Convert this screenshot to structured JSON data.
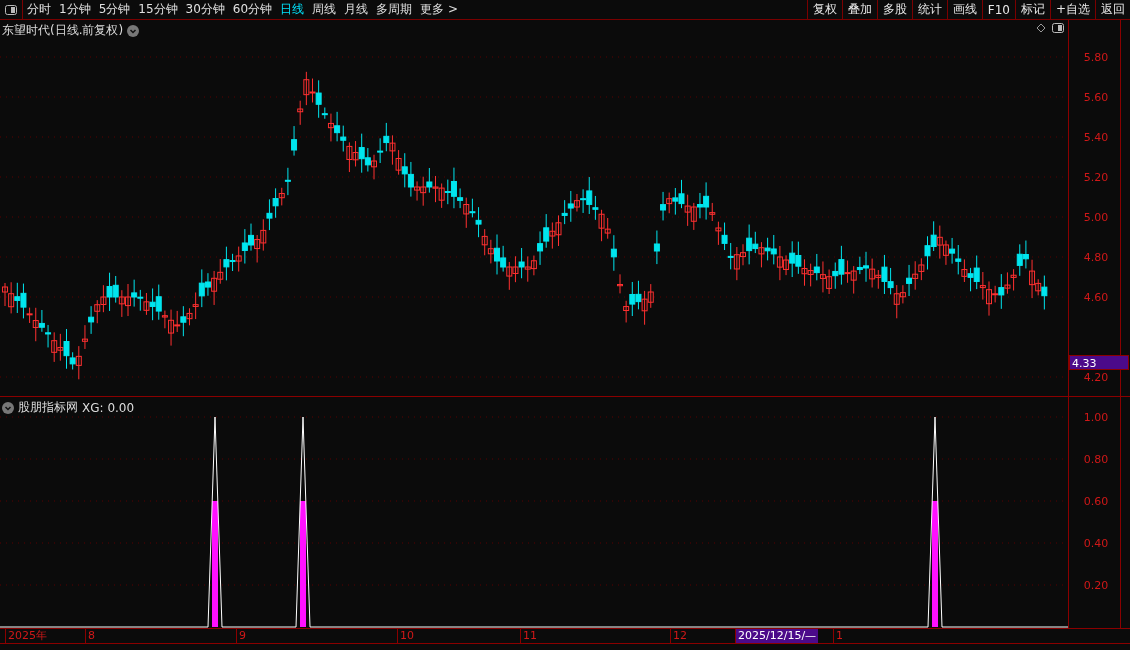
{
  "toolbar": {
    "periods": [
      {
        "label": "分时",
        "selected": false
      },
      {
        "label": "1分钟",
        "selected": false
      },
      {
        "label": "5分钟",
        "selected": false
      },
      {
        "label": "15分钟",
        "selected": false
      },
      {
        "label": "30分钟",
        "selected": false
      },
      {
        "label": "60分钟",
        "selected": false
      },
      {
        "label": "日线",
        "selected": true
      },
      {
        "label": "周线",
        "selected": false
      },
      {
        "label": "月线",
        "selected": false
      },
      {
        "label": "多周期",
        "selected": false
      },
      {
        "label": "更多 >",
        "selected": false
      }
    ],
    "actions": [
      "复权",
      "叠加",
      "多股",
      "统计",
      "画线",
      "F10",
      "标记",
      "+自选",
      "返回"
    ]
  },
  "price_panel": {
    "title": "东望时代(日线.前复权)",
    "axis_labels": [
      "5.80",
      "5.60",
      "5.40",
      "5.20",
      "5.00",
      "4.80",
      "4.60",
      "4.20"
    ],
    "current_price": "4.33"
  },
  "indicator_panel": {
    "name": "股朋指标网",
    "reading": "XG: 0.00",
    "axis_labels": [
      "1.00",
      "0.80",
      "0.60",
      "0.40",
      "0.20"
    ]
  },
  "time_axis": {
    "labels": [
      {
        "text": "2025年",
        "selected": false
      },
      {
        "text": "8",
        "selected": false
      },
      {
        "text": "9",
        "selected": false
      },
      {
        "text": "10",
        "selected": false
      },
      {
        "text": "11",
        "selected": false
      },
      {
        "text": "12",
        "selected": false
      },
      {
        "text": "2025/12/15/—",
        "selected": true
      },
      {
        "text": "1",
        "selected": false
      }
    ]
  }
}
